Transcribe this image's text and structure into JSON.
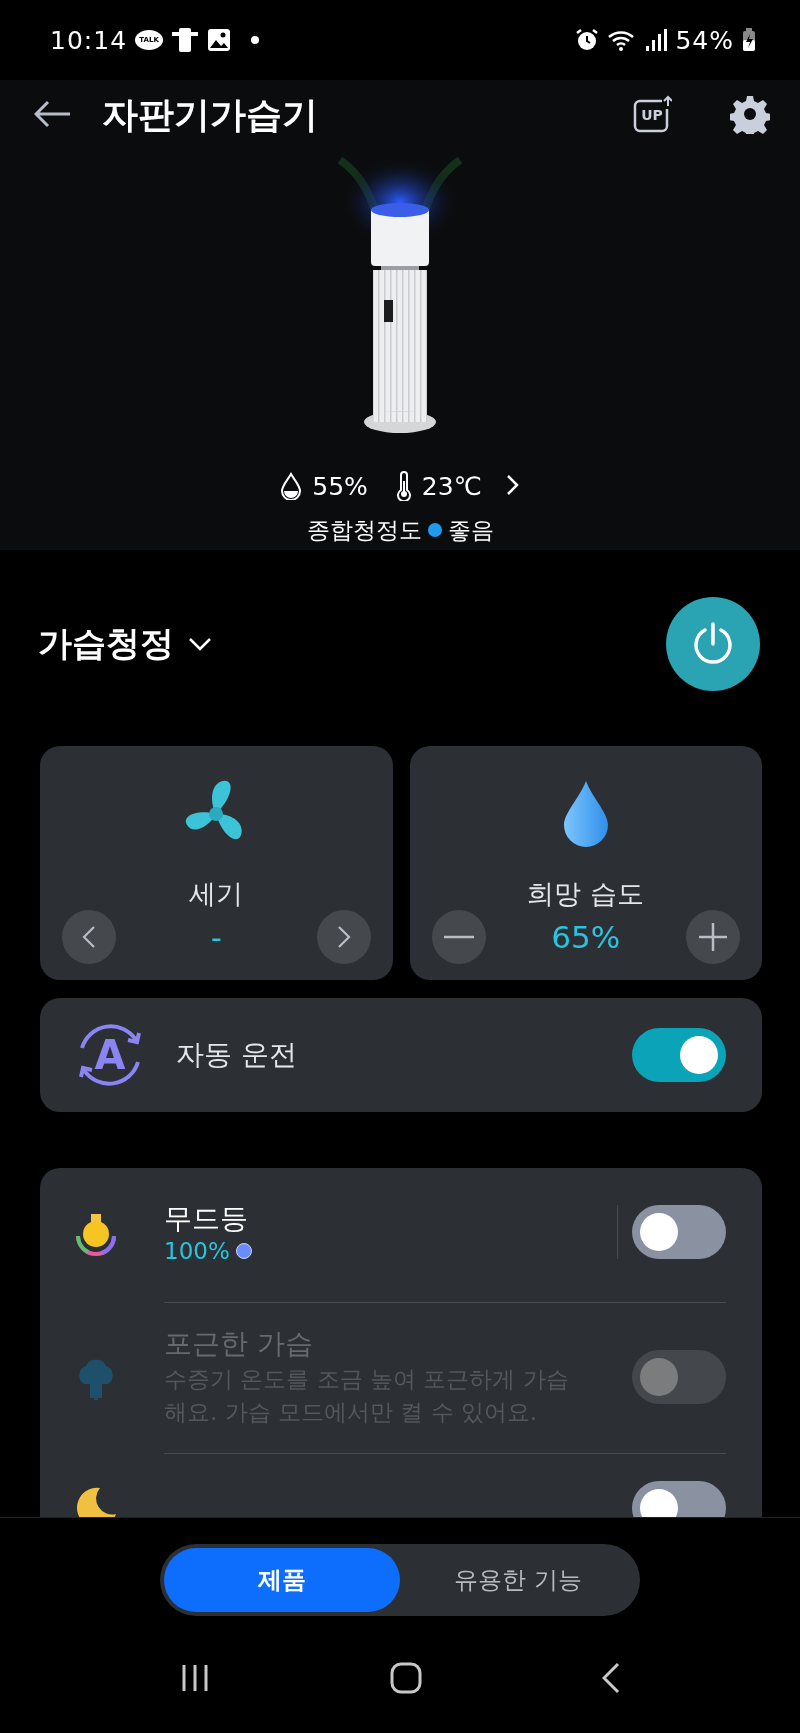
{
  "status_bar": {
    "time": "10:14",
    "talk_badge": "TALK",
    "battery": "54%"
  },
  "header": {
    "title": "자판기가습기",
    "update_label": "UP"
  },
  "environment": {
    "humidity": "55%",
    "temperature": "23℃",
    "air_quality": {
      "label": "종합청정도",
      "color": "#1e9bf0",
      "status": "좋음"
    }
  },
  "mode": {
    "name": "가습청정",
    "power": true
  },
  "controls": [
    {
      "kind": "fan-speed",
      "label": "세기",
      "value": "-"
    },
    {
      "kind": "target-humidity",
      "label": "희망 습도",
      "value": "65%"
    }
  ],
  "auto_operation": {
    "badge": "A",
    "label": "자동 운전",
    "on": true
  },
  "features": [
    {
      "kind": "mood-light",
      "title": "무드등",
      "subtitle": "100%",
      "color": "#6b8cff",
      "on": false,
      "disabled": false
    },
    {
      "kind": "warm-mist",
      "title": "포근한 가습",
      "description": "수증기 온도를 조금 높여 포근하게 가습해요. 가습 모드에서만 켤 수 있어요.",
      "on": false,
      "disabled": true
    },
    {
      "kind": "sleep",
      "on": false,
      "disabled": false
    }
  ],
  "tabs": [
    {
      "label": "제품",
      "selected": true
    },
    {
      "label": "유용한 기능",
      "selected": false
    }
  ]
}
